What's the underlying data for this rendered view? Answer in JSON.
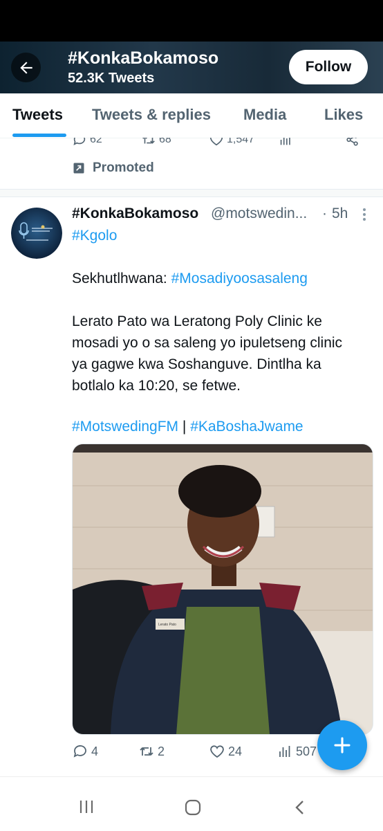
{
  "header": {
    "title": "#KonkaBokamoso",
    "subtitle": "52.3K Tweets",
    "follow_label": "Follow"
  },
  "tabs": [
    {
      "label": "Tweets",
      "active": true
    },
    {
      "label": "Tweets & replies",
      "active": false
    },
    {
      "label": "Media",
      "active": false
    },
    {
      "label": "Likes",
      "active": false
    }
  ],
  "previous_tweet": {
    "replies": "62",
    "retweets": "68",
    "likes": "1,547",
    "promoted_label": "Promoted"
  },
  "tweet": {
    "author_name": "#KonkaBokamoso",
    "handle": "@motswedin...",
    "separator": "·",
    "time": "5h",
    "hashtag_top": "#Kgolo",
    "line_sekhut_prefix": "Sekhutlhwana: ",
    "line_sekhut_tag": "#Mosadiyoosasaleng",
    "body_lines": [
      "Lerato Pato wa Leratong Poly Clinic ke",
      "mosadi yo o sa saleng yo ipuletseng clinic",
      "ya gagwe kwa Soshanguve. Dintlha ka",
      "botlalo ka 10:20, se fetwe."
    ],
    "tag_a": "#MotswedingFM",
    "tag_sep": " | ",
    "tag_b": "#KaBoshaJwame",
    "name_badge": "Lerato Pato",
    "replies": "4",
    "retweets": "2",
    "likes": "24",
    "views": "507"
  },
  "colors": {
    "accent": "#1d9bf0",
    "text_primary": "#0f1419",
    "text_secondary": "#536471"
  }
}
